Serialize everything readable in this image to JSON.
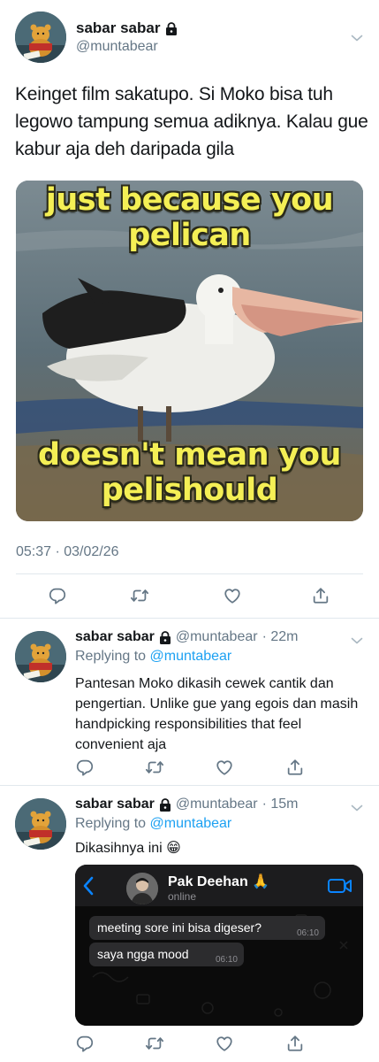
{
  "main_tweet": {
    "display_name": "sabar sabar",
    "handle": "@muntabear",
    "text": "Keinget film sakatupo. Si Moko bisa tuh legowo tampung semua adiknya. Kalau gue kabur aja deh daripada gila",
    "image": {
      "top_caption_line1": "just because you",
      "top_caption_line2": "pelican",
      "bottom_caption_line1": "doesn't mean you",
      "bottom_caption_line2": "pelishould"
    },
    "timestamp": "05:37 · 03/02/26"
  },
  "replies": [
    {
      "display_name": "sabar sabar",
      "handle": "@muntabear",
      "time": "· 22m",
      "replying_prefix": "Replying to",
      "replying_to": "@muntabear",
      "text": "Pantesan Moko dikasih cewek cantik dan pengertian. Unlike gue yang egois dan masih handpicking responsibilities that feel convenient aja"
    },
    {
      "display_name": "sabar sabar",
      "handle": "@muntabear",
      "time": "· 15m",
      "replying_prefix": "Replying to",
      "replying_to": "@muntabear",
      "text": "Dikasihnya ini 😁",
      "chat_screenshot": {
        "contact_name": "Pak Deehan 🙏",
        "status": "online",
        "messages": [
          {
            "text": "meeting sore ini bisa digeser?",
            "time": "06:10"
          },
          {
            "text": "saya ngga mood",
            "time": "06:10"
          }
        ]
      }
    }
  ],
  "icons": {
    "reply": "reply-icon",
    "retweet": "retweet-icon",
    "like": "like-icon",
    "share": "share-icon",
    "lock": "lock-icon",
    "caret": "chevron-down-icon"
  },
  "colors": {
    "text": "#14171a",
    "secondary": "#657786",
    "link": "#1da1f2",
    "divider": "#e1e8ed",
    "meme_caption": "#f4ef55",
    "whatsapp_accent": "#0a84ff"
  }
}
